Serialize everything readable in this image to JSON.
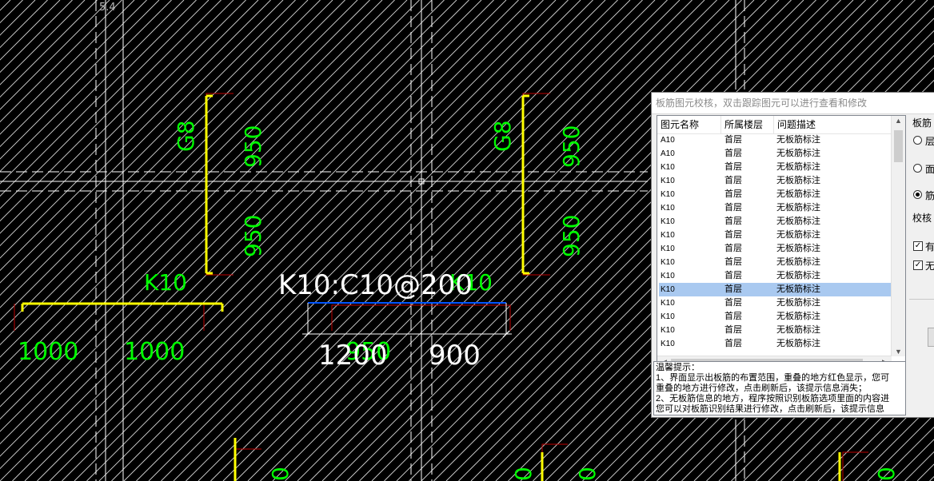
{
  "viewport": {
    "label": "5.4"
  },
  "cad": {
    "labels_g8": [
      "G8",
      "G8"
    ],
    "labels_950": [
      "950",
      "950",
      "950",
      "950"
    ],
    "label_k10": [
      "K10",
      "K10"
    ],
    "main_annotation": "K10:C10@200",
    "dims_left": [
      "1000",
      "1000"
    ],
    "dims_center": [
      "1200",
      "950",
      "900"
    ],
    "bottom_fragments": [
      "0",
      "0",
      "0",
      "0"
    ]
  },
  "dialog": {
    "title": "板筋图元校核，双击跟踪图元可以进行查看和修改",
    "columns": [
      "图元名称",
      "所属楼层",
      "问题描述"
    ],
    "rows": [
      {
        "name": "A10",
        "floor": "首层",
        "issue": "无板筋标注"
      },
      {
        "name": "A10",
        "floor": "首层",
        "issue": "无板筋标注"
      },
      {
        "name": "K10",
        "floor": "首层",
        "issue": "无板筋标注"
      },
      {
        "name": "K10",
        "floor": "首层",
        "issue": "无板筋标注"
      },
      {
        "name": "K10",
        "floor": "首层",
        "issue": "无板筋标注"
      },
      {
        "name": "K10",
        "floor": "首层",
        "issue": "无板筋标注"
      },
      {
        "name": "K10",
        "floor": "首层",
        "issue": "无板筋标注"
      },
      {
        "name": "K10",
        "floor": "首层",
        "issue": "无板筋标注"
      },
      {
        "name": "K10",
        "floor": "首层",
        "issue": "无板筋标注"
      },
      {
        "name": "K10",
        "floor": "首层",
        "issue": "无板筋标注"
      },
      {
        "name": "K10",
        "floor": "首层",
        "issue": "无板筋标注"
      },
      {
        "name": "K10",
        "floor": "首层",
        "issue": "无板筋标注"
      },
      {
        "name": "K10",
        "floor": "首层",
        "issue": "无板筋标注"
      },
      {
        "name": "K10",
        "floor": "首层",
        "issue": "无板筋标注"
      },
      {
        "name": "K10",
        "floor": "首层",
        "issue": "无板筋标注"
      },
      {
        "name": "K10",
        "floor": "首层",
        "issue": "无板筋标注"
      }
    ],
    "selected_row": 11,
    "notes": [
      "温馨提示：",
      "1、界面显示出板筋的布置范围，重叠的地方红色显示，您可",
      "重叠的地方进行修改，点击刷新后，该提示信息消失；",
      "2、无板筋信息的地方，程序按照识别板筋选项里面的内容进",
      "您可以对板筋识别结果进行修改，点击刷新后，该提示信息"
    ],
    "right_panel": {
      "group_label": "板筋",
      "radios": [
        {
          "frag": "层",
          "checked": false
        },
        {
          "frag": "面",
          "checked": false
        },
        {
          "frag": "筋",
          "checked": true
        }
      ],
      "check_label": "校核",
      "checks": [
        {
          "frag": "有",
          "checked": true
        },
        {
          "frag": "无",
          "checked": true
        }
      ]
    }
  },
  "colors": {
    "background": "#000000",
    "grid_line": "#ffffff",
    "hatch": "#ffffff",
    "green_text": "#00ff00",
    "yellow": "#ffff00",
    "red": "#c00000",
    "blue": "#0055ff",
    "selection": "#a9c9f0"
  }
}
